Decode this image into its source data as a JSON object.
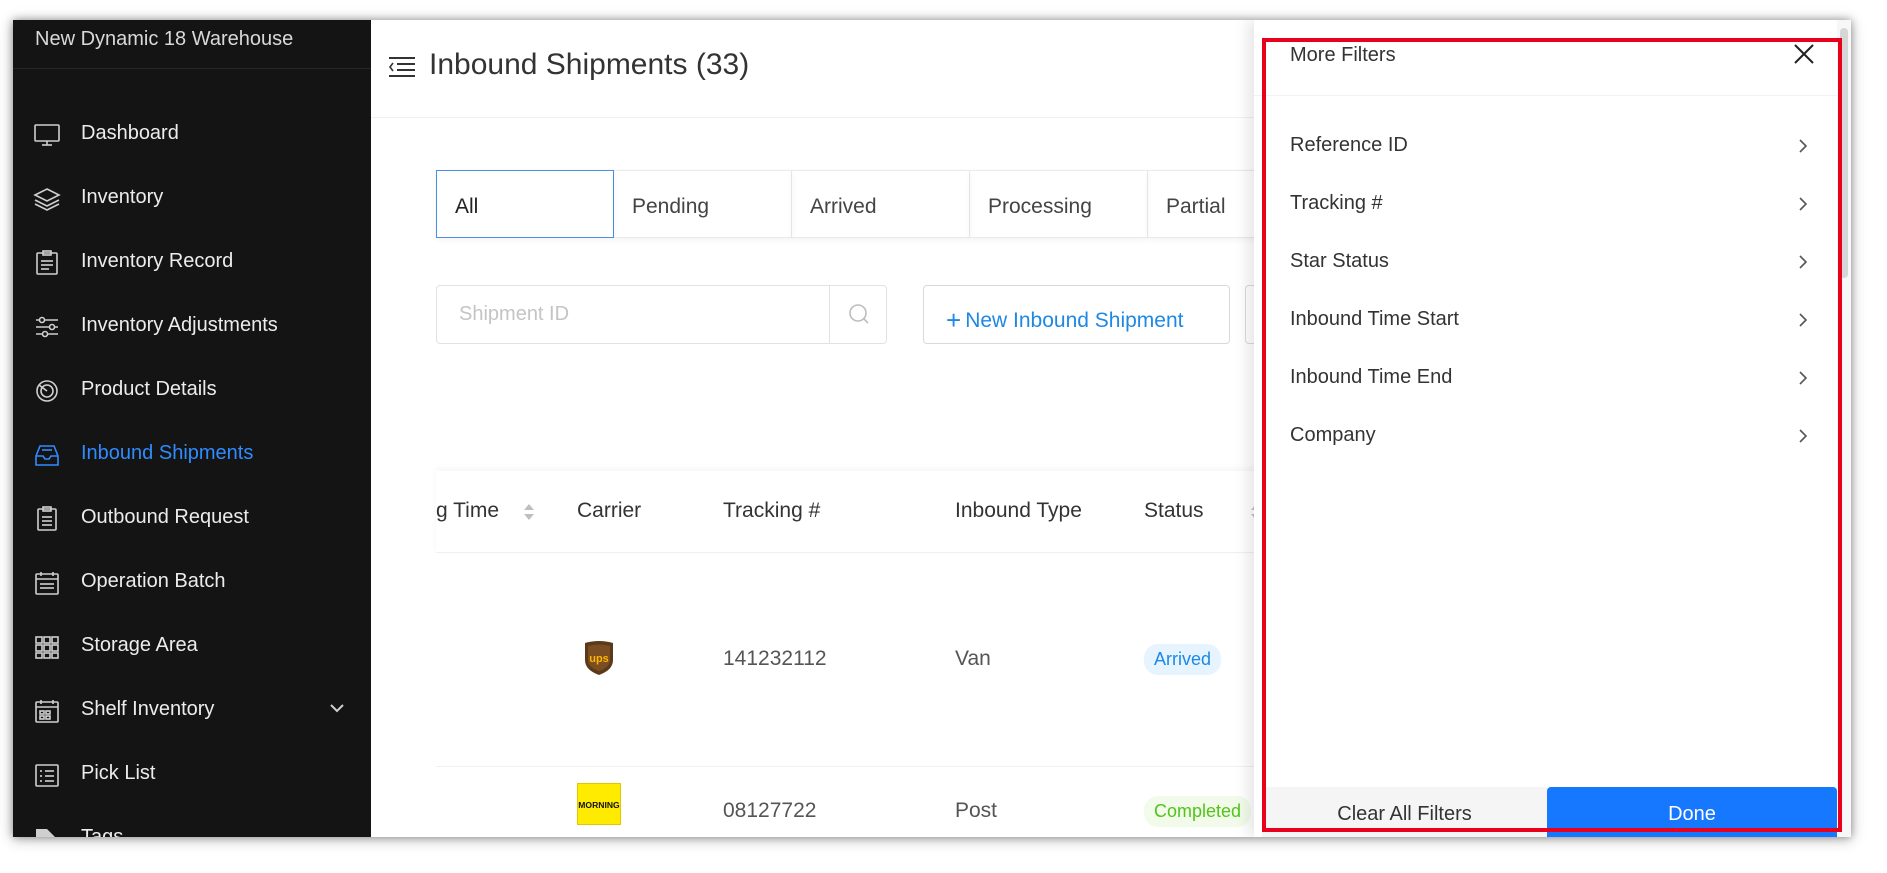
{
  "sidebar": {
    "brand": "New Dynamic 18 Warehouse",
    "items": [
      {
        "label": "Dashboard",
        "icon": "monitor-icon"
      },
      {
        "label": "Inventory",
        "icon": "layers-icon"
      },
      {
        "label": "Inventory Record",
        "icon": "clipboard-record-icon"
      },
      {
        "label": "Inventory Adjustments",
        "icon": "sliders-icon"
      },
      {
        "label": "Product Details",
        "icon": "product-globe-icon"
      },
      {
        "label": "Inbound Shipments",
        "icon": "inbox-tray-icon"
      },
      {
        "label": "Outbound Request",
        "icon": "outbound-list-icon"
      },
      {
        "label": "Operation Batch",
        "icon": "batch-calendar-icon"
      },
      {
        "label": "Storage Area",
        "icon": "grid-icon"
      },
      {
        "label": "Shelf Inventory",
        "icon": "shelf-calendar-icon"
      },
      {
        "label": "Pick List",
        "icon": "pick-list-icon"
      },
      {
        "label": "Tags",
        "icon": "tag-icon"
      }
    ],
    "active_color": "#2f8cff"
  },
  "main": {
    "title": "Inbound Shipments (33)",
    "tabs": [
      "All",
      "Pending",
      "Arrived",
      "Processing",
      "Partial"
    ],
    "search_placeholder": "Shipment ID",
    "new_button": "New Inbound Shipment",
    "table": {
      "columns": [
        "g Time",
        "Carrier",
        "Tracking #",
        "Inbound Type",
        "Status"
      ],
      "rows": [
        {
          "carrier": "UPS",
          "tracking": "141232112",
          "type": "Van",
          "status": "Arrived"
        },
        {
          "carrier": "Morning",
          "tracking": "08127722",
          "type": "Post",
          "status": "Completed"
        }
      ]
    }
  },
  "drawer": {
    "title": "More Filters",
    "filters": [
      "Reference ID",
      "Tracking #",
      "Star Status",
      "Inbound Time Start",
      "Inbound Time End",
      "Company"
    ],
    "clear_label": "Clear All Filters",
    "done_label": "Done",
    "primary_color": "#1677ff",
    "highlight_color": "#e8001c"
  }
}
